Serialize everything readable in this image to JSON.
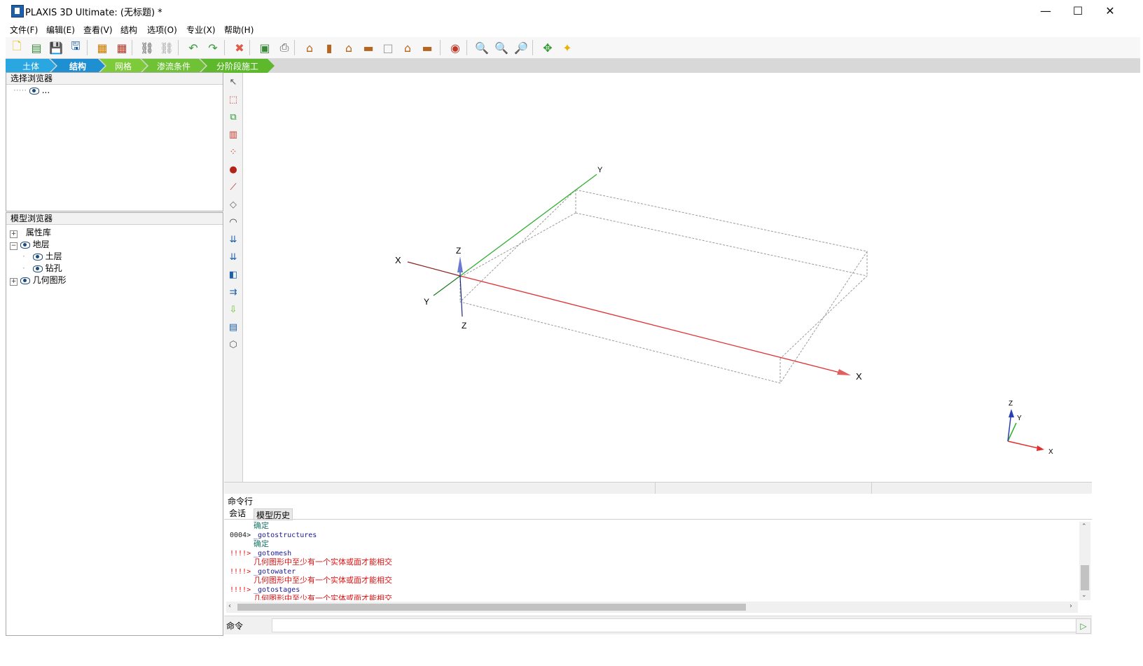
{
  "window": {
    "title": "PLAXIS 3D Ultimate: (无标题) *",
    "minimize": "—",
    "maximize": "☐",
    "close": "✕"
  },
  "menu": [
    "文件(F)",
    "编辑(E)",
    "查看(V)",
    "结构",
    "选项(O)",
    "专业(X)",
    "帮助(H)"
  ],
  "toolbar_icons": [
    {
      "name": "new-project-icon",
      "glyph": "🗋",
      "color": "#e8b400"
    },
    {
      "name": "open-project-icon",
      "glyph": "▤",
      "color": "#3a8a3a"
    },
    {
      "name": "save-project-icon",
      "glyph": "💾",
      "color": "#1e5fa8"
    },
    {
      "name": "save-as-icon",
      "glyph": "🖫",
      "color": "#1e5fa8"
    },
    {
      "name": "import-icon",
      "glyph": "▦",
      "color": "#d07a00"
    },
    {
      "name": "export-icon",
      "glyph": "▦",
      "color": "#b53a2a"
    },
    {
      "name": "link-icon",
      "glyph": "⛓",
      "color": "#444"
    },
    {
      "name": "unlink-icon",
      "glyph": "⛓",
      "color": "#999"
    },
    {
      "name": "undo-icon",
      "glyph": "↶",
      "color": "#3a9a3a"
    },
    {
      "name": "redo-icon",
      "glyph": "↷",
      "color": "#3a9a3a"
    },
    {
      "name": "delete-icon",
      "glyph": "✖",
      "color": "#e05a4a"
    },
    {
      "name": "report-icon",
      "glyph": "▣",
      "color": "#3a8a3a"
    },
    {
      "name": "print-icon",
      "glyph": "⎙",
      "color": "#555"
    },
    {
      "name": "view-default-icon",
      "glyph": "⌂",
      "color": "#b5651d"
    },
    {
      "name": "view-front-icon",
      "glyph": "▮",
      "color": "#b5651d"
    },
    {
      "name": "view-back-icon",
      "glyph": "⌂",
      "color": "#b5651d"
    },
    {
      "name": "view-top-icon",
      "glyph": "▬",
      "color": "#b5651d"
    },
    {
      "name": "view-blank-icon",
      "glyph": "□",
      "color": "#999"
    },
    {
      "name": "view-side-icon",
      "glyph": "⌂",
      "color": "#b5651d"
    },
    {
      "name": "view-bottom-icon",
      "glyph": "▬",
      "color": "#b5651d"
    },
    {
      "name": "camera-icon",
      "glyph": "◉",
      "color": "#c0392b"
    },
    {
      "name": "zoom-in-icon",
      "glyph": "🔍",
      "color": "#1e5fa8"
    },
    {
      "name": "zoom-out-icon",
      "glyph": "🔍",
      "color": "#1e5fa8"
    },
    {
      "name": "zoom-window-icon",
      "glyph": "🔎",
      "color": "#1e5fa8"
    },
    {
      "name": "pan-icon",
      "glyph": "✥",
      "color": "#2e9a2e"
    },
    {
      "name": "rotate-icon",
      "glyph": "✦",
      "color": "#e8b400"
    }
  ],
  "mode_tabs": [
    "土体",
    "结构",
    "网格",
    "渗流条件",
    "分阶段施工"
  ],
  "selection_explorer": {
    "title": "选择浏览器",
    "item": "..."
  },
  "model_explorer": {
    "title": "模型浏览器",
    "items": [
      {
        "label": "属性库",
        "level": 0,
        "toggle": "+",
        "eye": false
      },
      {
        "label": "地层",
        "level": 0,
        "toggle": "−",
        "eye": true
      },
      {
        "label": "土层",
        "level": 1,
        "toggle": "",
        "eye": true
      },
      {
        "label": "钻孔",
        "level": 1,
        "toggle": "",
        "eye": true
      },
      {
        "label": "几何图形",
        "level": 0,
        "toggle": "+",
        "eye": true
      }
    ]
  },
  "vertical_tools": [
    {
      "name": "select-tool-icon",
      "glyph": "↖",
      "color": "#555"
    },
    {
      "name": "rectangle-select-icon",
      "glyph": "⬚",
      "color": "#c0392b"
    },
    {
      "name": "move-object-icon",
      "glyph": "⧉",
      "color": "#2e9a2e"
    },
    {
      "name": "create-box-icon",
      "glyph": "▥",
      "color": "#c0392b"
    },
    {
      "name": "create-array-icon",
      "glyph": "⁘",
      "color": "#c0392b"
    },
    {
      "name": "create-point-icon",
      "glyph": "●",
      "color": "#b0241a"
    },
    {
      "name": "create-line-icon",
      "glyph": "⟋",
      "color": "#b0241a"
    },
    {
      "name": "create-surface-icon",
      "glyph": "◇",
      "color": "#666"
    },
    {
      "name": "create-tunnel-icon",
      "glyph": "◠",
      "color": "#333"
    },
    {
      "name": "point-load-icon",
      "glyph": "⇊",
      "color": "#1e5fa8"
    },
    {
      "name": "line-load-icon",
      "glyph": "⇊",
      "color": "#1e5fa8"
    },
    {
      "name": "surface-load-icon",
      "glyph": "◧",
      "color": "#1e5fa8"
    },
    {
      "name": "prescribed-displacement-icon",
      "glyph": "⇉",
      "color": "#1e5fa8"
    },
    {
      "name": "import-geometry-icon",
      "glyph": "⇩",
      "color": "#6bbf2a"
    },
    {
      "name": "show-materials-icon",
      "glyph": "▤",
      "color": "#1e5fa8"
    },
    {
      "name": "design-approaches-icon",
      "glyph": "⬡",
      "color": "#555"
    }
  ],
  "viewport": {
    "main_axes": {
      "x_label": "X",
      "y_label": "Y",
      "z_label": "Z"
    },
    "mini_axes": {
      "x_label": "X",
      "y_label": "Y",
      "z_label": "Z"
    },
    "colors": {
      "x_axis": "#e03030",
      "y_axis": "#30b030",
      "z_axis": "#2a3fb0",
      "box_edge": "#9a9a9a"
    }
  },
  "command_panel": {
    "title": "命令行",
    "tabs": [
      "会话",
      "模型历史"
    ],
    "lines": [
      {
        "prefix": "",
        "text": "确定",
        "kind": "ok"
      },
      {
        "prefix": "0004>",
        "text": "_gotostructures",
        "kind": "cmd"
      },
      {
        "prefix": "",
        "text": "确定",
        "kind": "ok"
      },
      {
        "prefix": "!!!!>",
        "text": "_gotomesh",
        "kind": "cmd"
      },
      {
        "prefix": "",
        "text": "几何图形中至少有一个实体或面才能相交",
        "kind": "err"
      },
      {
        "prefix": "!!!!>",
        "text": "_gotowater",
        "kind": "cmd"
      },
      {
        "prefix": "",
        "text": "几何图形中至少有一个实体或面才能相交",
        "kind": "err"
      },
      {
        "prefix": "!!!!>",
        "text": "_gotostages",
        "kind": "cmd"
      },
      {
        "prefix": "",
        "text": "几何图形中至少有一个实体或面才能相交",
        "kind": "err"
      }
    ],
    "input_label": "命令",
    "input_value": "",
    "run_glyph": "▷",
    "colors": {
      "ok": "#1a7a6a",
      "cmd": "#1a1a9a",
      "err": "#e01010",
      "prefix_err": "#e01010",
      "prefix_ok": "#222"
    }
  }
}
